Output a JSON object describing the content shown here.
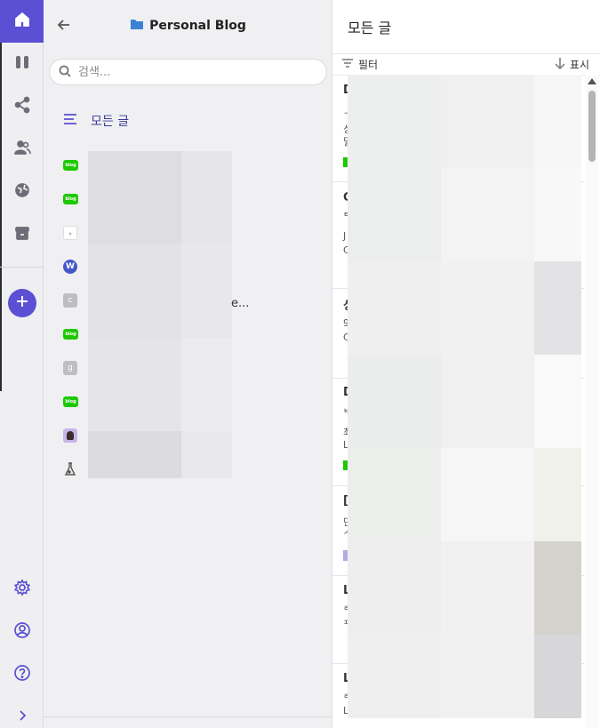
{
  "rail": {
    "items": [
      {
        "name": "home-icon"
      },
      {
        "name": "columns-icon"
      },
      {
        "name": "share-icon"
      },
      {
        "name": "users-icon"
      },
      {
        "name": "globe-icon"
      },
      {
        "name": "archive-icon"
      }
    ],
    "add_icon": "plus-icon",
    "bottom": [
      {
        "name": "settings-icon"
      },
      {
        "name": "account-icon"
      },
      {
        "name": "help-icon"
      },
      {
        "name": "expand-icon"
      }
    ],
    "accent": "#5b4fd3"
  },
  "sidebar": {
    "folder_title": "Personal Blog",
    "search_placeholder": "검색...",
    "all_posts_label": "모든 글",
    "sources": [
      {
        "icon": "blog",
        "icon_text": "blog"
      },
      {
        "icon": "blog",
        "icon_text": "blog"
      },
      {
        "icon": "white",
        "icon_text": "▴"
      },
      {
        "icon": "wordpress",
        "icon_text": "W"
      },
      {
        "icon": "letter",
        "icon_text": "c"
      },
      {
        "icon": "blog",
        "icon_text": "blog"
      },
      {
        "icon": "letter",
        "icon_text": "g"
      },
      {
        "icon": "blog",
        "icon_text": "blog"
      },
      {
        "icon": "avatar",
        "icon_text": ""
      },
      {
        "icon": "flask",
        "icon_text": ""
      }
    ],
    "truncated_suffix": "e..."
  },
  "main": {
    "title": "모든 글",
    "filter_label": "필터",
    "sort_label": "표시",
    "posts": [
      {
        "letter": "D",
        "lines": [
          "ᄀ",
          "싱",
          "딜"
        ]
      },
      {
        "letter": "C",
        "lines": [
          "ᄐ",
          "J",
          "C"
        ]
      },
      {
        "letter": "싱",
        "lines": [
          "9",
          "C"
        ]
      },
      {
        "letter": "D",
        "lines": [
          "ᄇ",
          "최",
          "L"
        ]
      },
      {
        "letter": "[",
        "lines": [
          "딘",
          "ᄉ"
        ]
      },
      {
        "letter": "L",
        "lines": [
          "ᄅ",
          "ᄑ"
        ]
      },
      {
        "letter": "L",
        "lines": [
          "ᄅ",
          "L"
        ]
      }
    ]
  }
}
